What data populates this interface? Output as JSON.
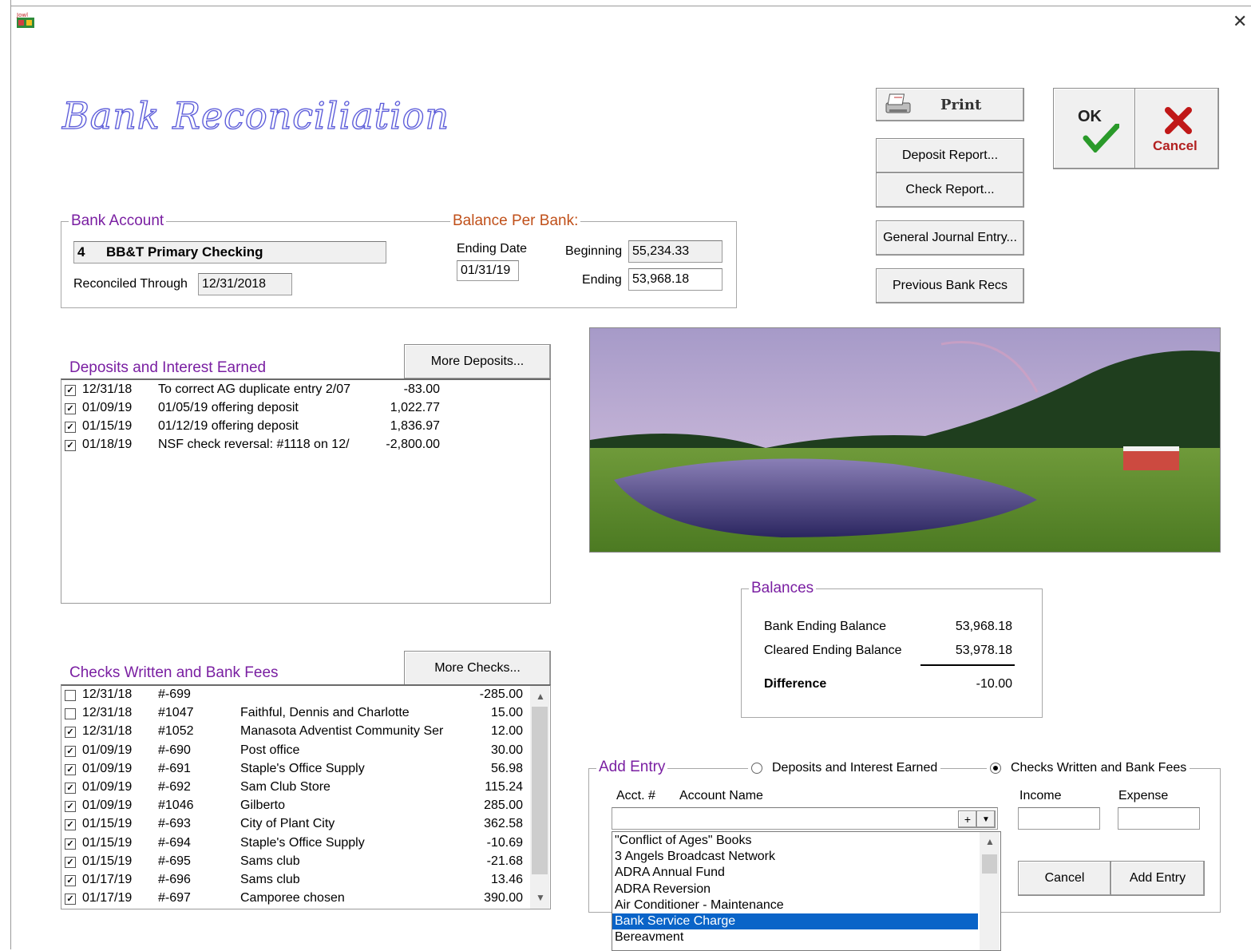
{
  "window": {
    "app_icon": "app-logo-icon",
    "close_icon": "close-icon",
    "title": "Bank Reconciliation"
  },
  "toolbar": {
    "print_label": "Print",
    "deposit_report_label": "Deposit Report...",
    "check_report_label": "Check Report...",
    "general_journal_label": "General Journal Entry...",
    "previous_recs_label": "Previous Bank Recs",
    "ok_label": "OK",
    "cancel_label": "Cancel"
  },
  "bank_account": {
    "group_label": "Bank Account",
    "number": "4",
    "name": "BB&T Primary Checking",
    "reconciled_label": "Reconciled Through",
    "reconciled_value": "12/31/2018"
  },
  "balance_per_bank": {
    "group_label": "Balance Per Bank:",
    "ending_date_label": "Ending Date",
    "ending_date_value": "01/31/19",
    "beginning_label": "Beginning",
    "beginning_value": "55,234.33",
    "ending_label": "Ending",
    "ending_value": "53,968.18"
  },
  "deposits": {
    "title": "Deposits and Interest Earned",
    "more_label": "More Deposits...",
    "rows": [
      {
        "checked": true,
        "date": "12/31/18",
        "desc": "To correct AG duplicate entry 2/07",
        "amount": "-83.00"
      },
      {
        "checked": true,
        "date": "01/09/19",
        "desc": "01/05/19 offering deposit",
        "amount": "1,022.77"
      },
      {
        "checked": true,
        "date": "01/15/19",
        "desc": "01/12/19 offering deposit",
        "amount": "1,836.97"
      },
      {
        "checked": true,
        "date": "01/18/19",
        "desc": "NSF check reversal: #1118 on 12/",
        "amount": "-2,800.00"
      }
    ]
  },
  "checks": {
    "title": "Checks Written and Bank Fees",
    "more_label": "More Checks...",
    "rows": [
      {
        "checked": false,
        "date": "12/31/18",
        "num": "#-699",
        "payee": "",
        "amount": "-285.00"
      },
      {
        "checked": false,
        "date": "12/31/18",
        "num": "#1047",
        "payee": "Faithful, Dennis and Charlotte",
        "amount": "15.00"
      },
      {
        "checked": true,
        "date": "12/31/18",
        "num": "#1052",
        "payee": "Manasota Adventist Community Ser",
        "amount": "12.00"
      },
      {
        "checked": true,
        "date": "01/09/19",
        "num": "#-690",
        "payee": "Post office",
        "amount": "30.00"
      },
      {
        "checked": true,
        "date": "01/09/19",
        "num": "#-691",
        "payee": "Staple's Office Supply",
        "amount": "56.98"
      },
      {
        "checked": true,
        "date": "01/09/19",
        "num": "#-692",
        "payee": "Sam Club Store",
        "amount": "115.24"
      },
      {
        "checked": true,
        "date": "01/09/19",
        "num": "#1046",
        "payee": "Gilberto",
        "amount": "285.00"
      },
      {
        "checked": true,
        "date": "01/15/19",
        "num": "#-693",
        "payee": "City of Plant City",
        "amount": "362.58"
      },
      {
        "checked": true,
        "date": "01/15/19",
        "num": "#-694",
        "payee": "Staple's Office Supply",
        "amount": "-10.69"
      },
      {
        "checked": true,
        "date": "01/15/19",
        "num": "#-695",
        "payee": "Sams club",
        "amount": "-21.68"
      },
      {
        "checked": true,
        "date": "01/17/19",
        "num": "#-696",
        "payee": "Sams club",
        "amount": "13.46"
      },
      {
        "checked": true,
        "date": "01/17/19",
        "num": "#-697",
        "payee": "Camporee chosen",
        "amount": "390.00"
      }
    ]
  },
  "balances": {
    "group_label": "Balances",
    "bank_ending_label": "Bank Ending Balance",
    "bank_ending_value": "53,968.18",
    "cleared_ending_label": "Cleared Ending Balance",
    "cleared_ending_value": "53,978.18",
    "difference_label": "Difference",
    "difference_value": "-10.00"
  },
  "add_entry": {
    "group_label": "Add Entry",
    "radio_deposits_label": "Deposits and Interest Earned",
    "radio_checks_label": "Checks Written and Bank Fees",
    "selected_radio": "checks",
    "acct_label": "Acct. #",
    "account_name_label": "Account Name",
    "income_label": "Income",
    "expense_label": "Expense",
    "plus_label": "+",
    "cancel_label": "Cancel",
    "add_label": "Add Entry",
    "dropdown_options": [
      "\"Conflict of Ages\" Books",
      "3 Angels Broadcast Network",
      "ADRA Annual Fund",
      "ADRA Reversion",
      "Air Conditioner - Maintenance",
      "Bank Service Charge",
      "Bereavment"
    ],
    "selected_option_index": 5
  },
  "colors": {
    "group_purple": "#7a1fa2",
    "group_orange": "#c0501a",
    "selection_blue": "#0a64c8",
    "title_outline": "#5a5ad8"
  }
}
